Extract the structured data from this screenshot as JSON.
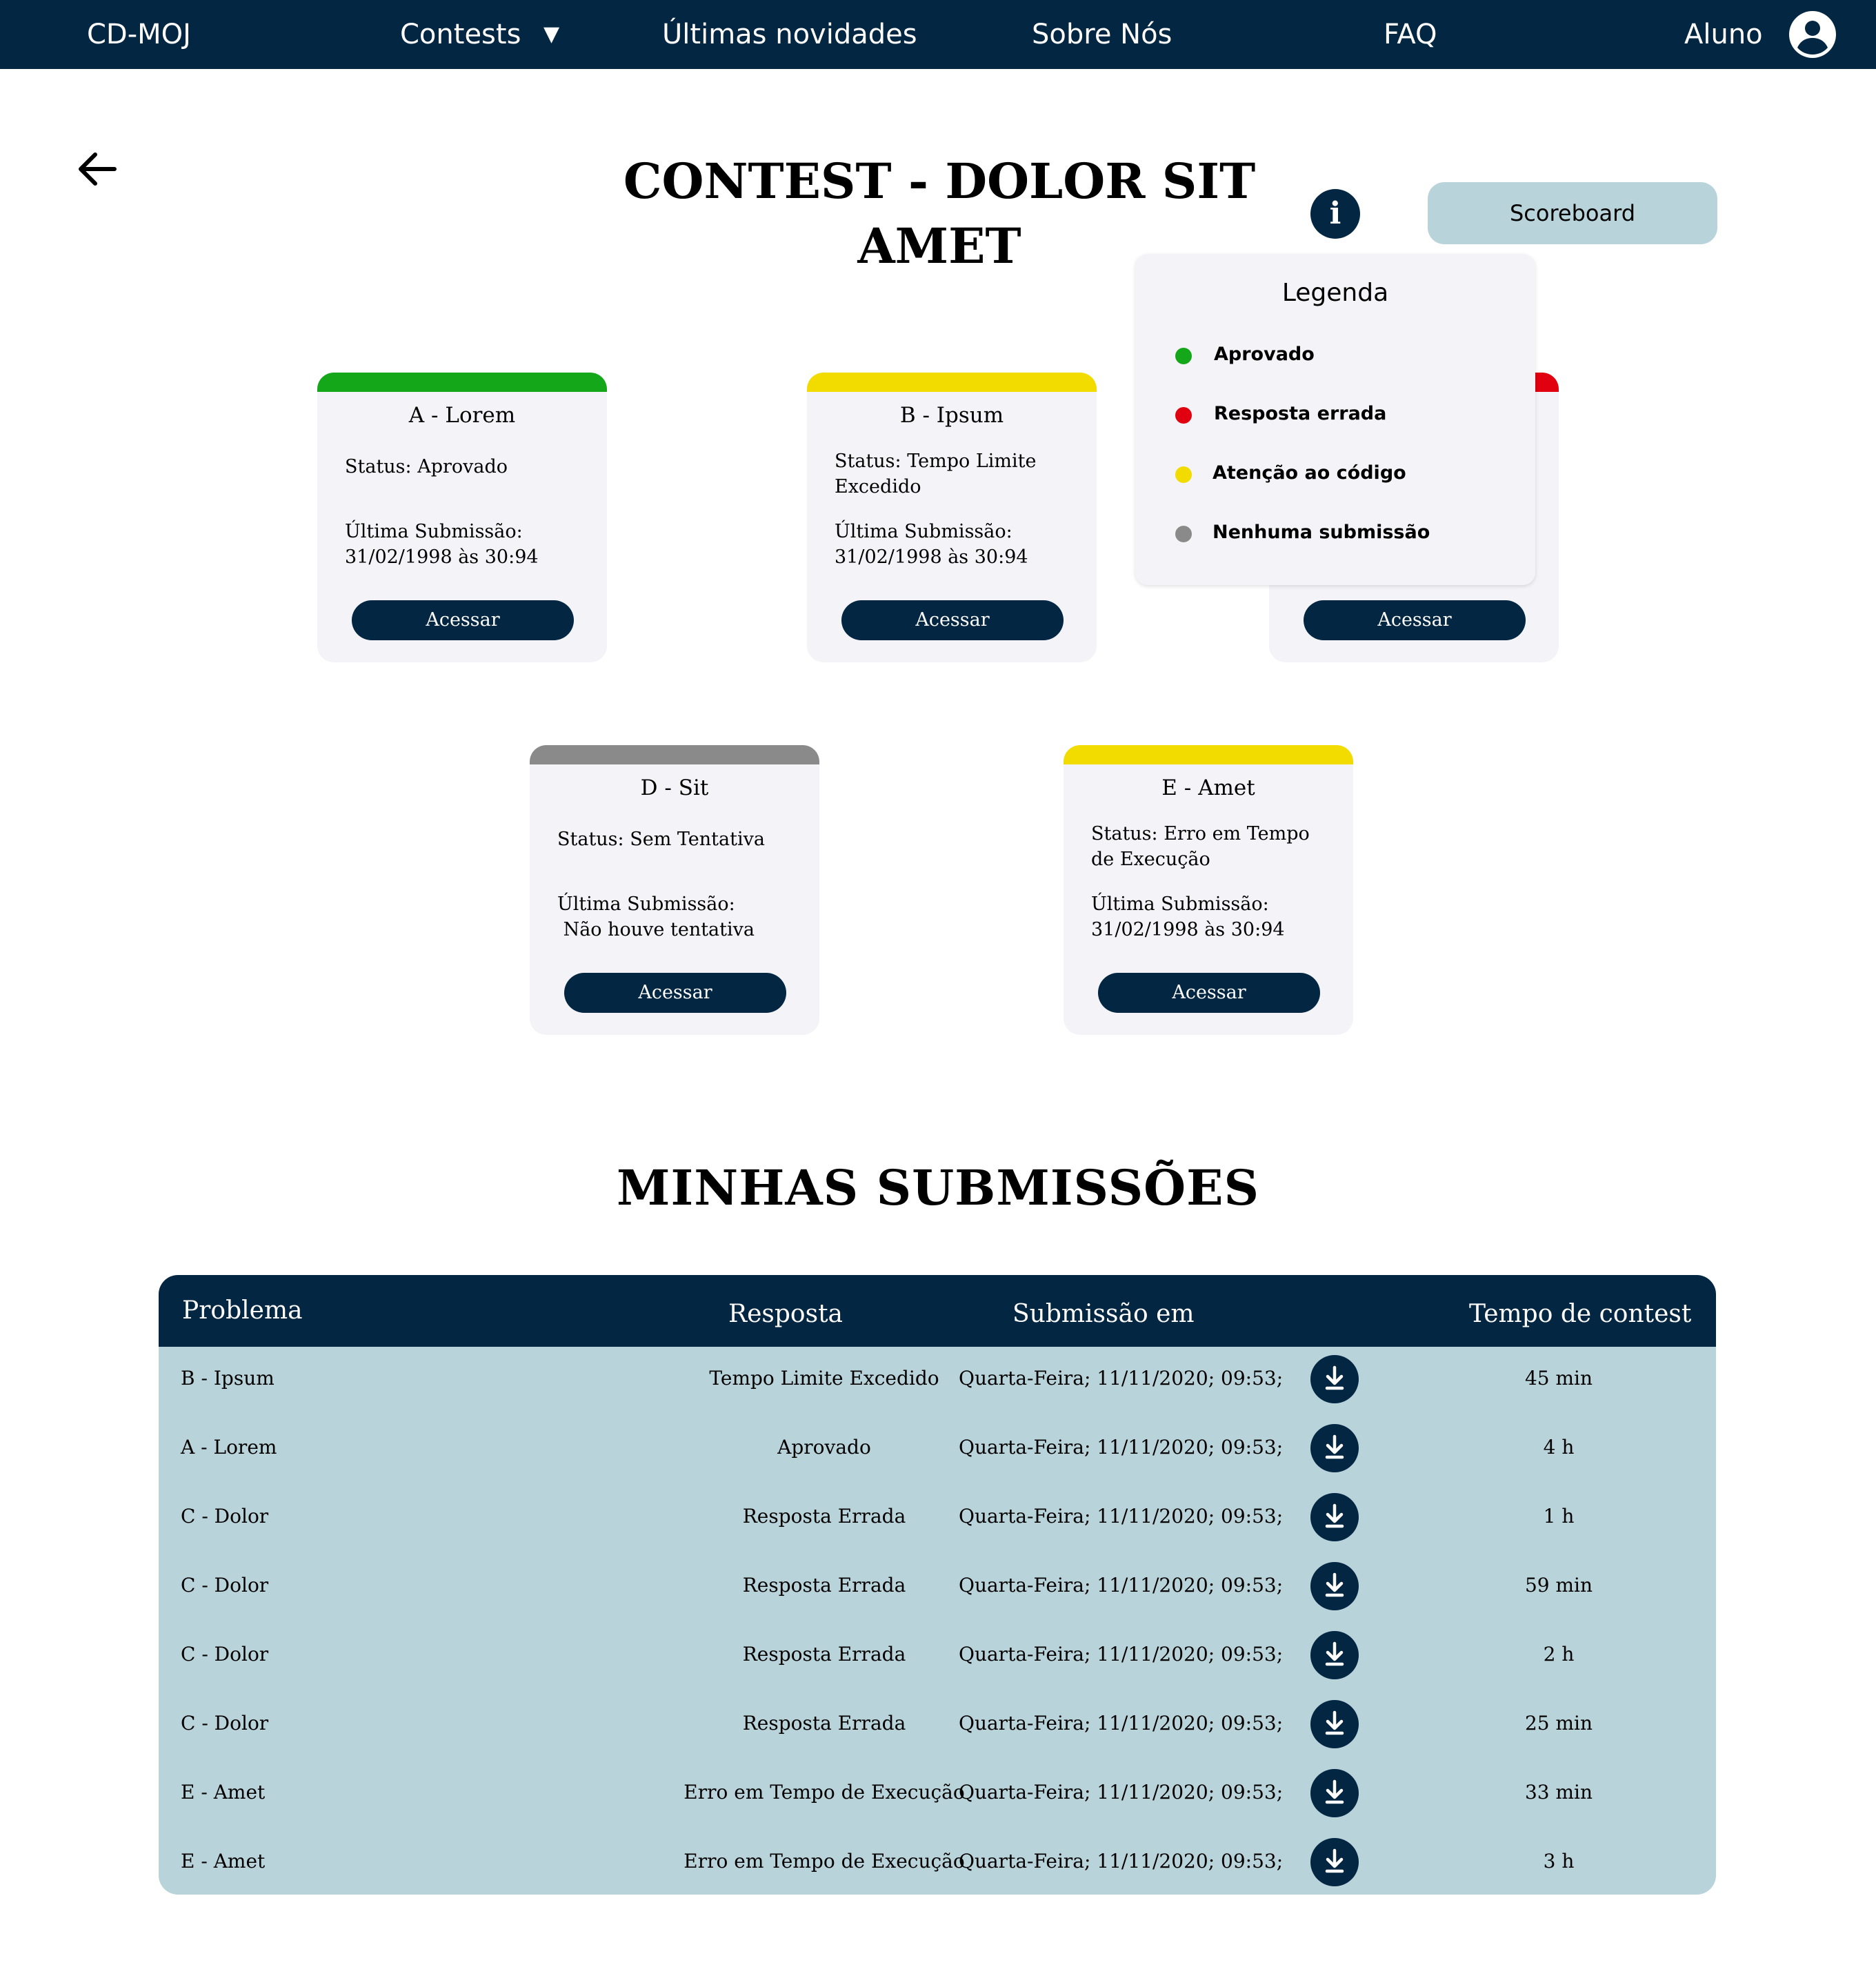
{
  "nav": {
    "brand": "CD-MOJ",
    "contests": "Contests",
    "caret": "▼",
    "news": "Últimas novidades",
    "about": "Sobre Nós",
    "faq": "FAQ",
    "user": "Aluno"
  },
  "header": {
    "title_line1": "CONTEST - DOLOR SIT",
    "title_line2": "AMET",
    "info_glyph": "i",
    "scoreboard": "Scoreboard"
  },
  "colors": {
    "navy": "#032642",
    "approved": "#14a71a",
    "wrong": "#e0000f",
    "attention": "#f2dc00",
    "none": "#8a8a8a",
    "table_bg": "#b8d3da",
    "card_bg": "#f4f4f8"
  },
  "cards": [
    {
      "title": "A - Lorem",
      "status": "Status:  Aprovado",
      "last_label": "Última Submissão:",
      "last_value": "31/02/1998 às 30:94",
      "button": "Acessar",
      "color": "#14a71a"
    },
    {
      "title": "B - Ipsum",
      "status": "Status:  Tempo Limite Excedido",
      "last_label": "Última Submissão:",
      "last_value": "31/02/1998 às 30:94",
      "button": "Acessar",
      "color": "#f2dc00"
    },
    {
      "title": "",
      "status": "",
      "last_label": "",
      "last_value": "",
      "button": "Acessar",
      "color": "#e0000f"
    },
    {
      "title": "D - Sit",
      "status": "Status:  Sem Tentativa",
      "last_label": "Última Submissão:",
      "last_value": " Não houve tentativa",
      "button": "Acessar",
      "color": "#8a8a8a"
    },
    {
      "title": "E - Amet",
      "status": "Status: Erro em Tempo de Execução",
      "last_label": "Última Submissão:",
      "last_value": "31/02/1998 às 30:94",
      "button": "Acessar",
      "color": "#f2dc00"
    }
  ],
  "legend": {
    "title": "Legenda",
    "items": [
      {
        "label": "Aprovado",
        "color": "#14a71a"
      },
      {
        "label": "Resposta errada",
        "color": "#e0000f"
      },
      {
        "label": "Atenção ao código",
        "color": "#f2dc00"
      },
      {
        "label": "Nenhuma submissão",
        "color": "#8a8a8a"
      }
    ]
  },
  "submissions": {
    "title": "MINHAS SUBMISSÕES",
    "columns": [
      "Problema",
      "Resposta",
      "Submissão em",
      "Tempo de contest"
    ],
    "rows": [
      {
        "problem": "B - Ipsum",
        "answer": "Tempo Limite Excedido",
        "submitted": "Quarta-Feira; 11/11/2020; 09:53;",
        "time": "45 min"
      },
      {
        "problem": "A - Lorem",
        "answer": "Aprovado",
        "submitted": "Quarta-Feira; 11/11/2020; 09:53;",
        "time": "4 h"
      },
      {
        "problem": "C - Dolor",
        "answer": "Resposta Errada",
        "submitted": "Quarta-Feira; 11/11/2020; 09:53;",
        "time": "1 h"
      },
      {
        "problem": "C - Dolor",
        "answer": "Resposta Errada",
        "submitted": "Quarta-Feira; 11/11/2020; 09:53;",
        "time": "59 min"
      },
      {
        "problem": "C - Dolor",
        "answer": "Resposta Errada",
        "submitted": "Quarta-Feira; 11/11/2020; 09:53;",
        "time": "2  h"
      },
      {
        "problem": "C - Dolor",
        "answer": "Resposta Errada",
        "submitted": "Quarta-Feira; 11/11/2020; 09:53;",
        "time": "25 min"
      },
      {
        "problem": "E - Amet",
        "answer": "Erro em Tempo de Execução",
        "submitted": "Quarta-Feira; 11/11/2020; 09:53;",
        "time": "33 min"
      },
      {
        "problem": "E - Amet",
        "answer": "Erro em Tempo de Execução",
        "submitted": "Quarta-Feira; 11/11/2020; 09:53;",
        "time": "3 h"
      }
    ]
  }
}
